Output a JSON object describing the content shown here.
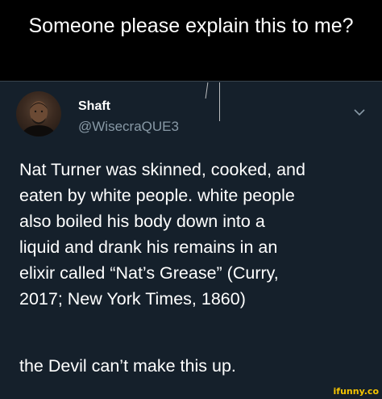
{
  "caption": {
    "text": "Someone please explain this to me?"
  },
  "tweet": {
    "author_name": "Shaft",
    "author_handle": "@WisecraQUE3",
    "body_paragraph_1": "Nat Turner was skinned, cooked, and\neaten by white people. white people\nalso boiled his body down into a\nliquid and drank his remains in an\nelixir called “Nat’s Grease” (Curry,\n2017; New York Times, 1860)",
    "body_paragraph_2": "the Devil can’t make this up.",
    "menu_icon": "chevron-down-icon"
  },
  "watermark": {
    "text": "ifunny.co"
  },
  "colors": {
    "caption_bg": "#000000",
    "tweet_bg": "#15202b",
    "handle": "#8899a6",
    "watermark": "#f5c400"
  }
}
